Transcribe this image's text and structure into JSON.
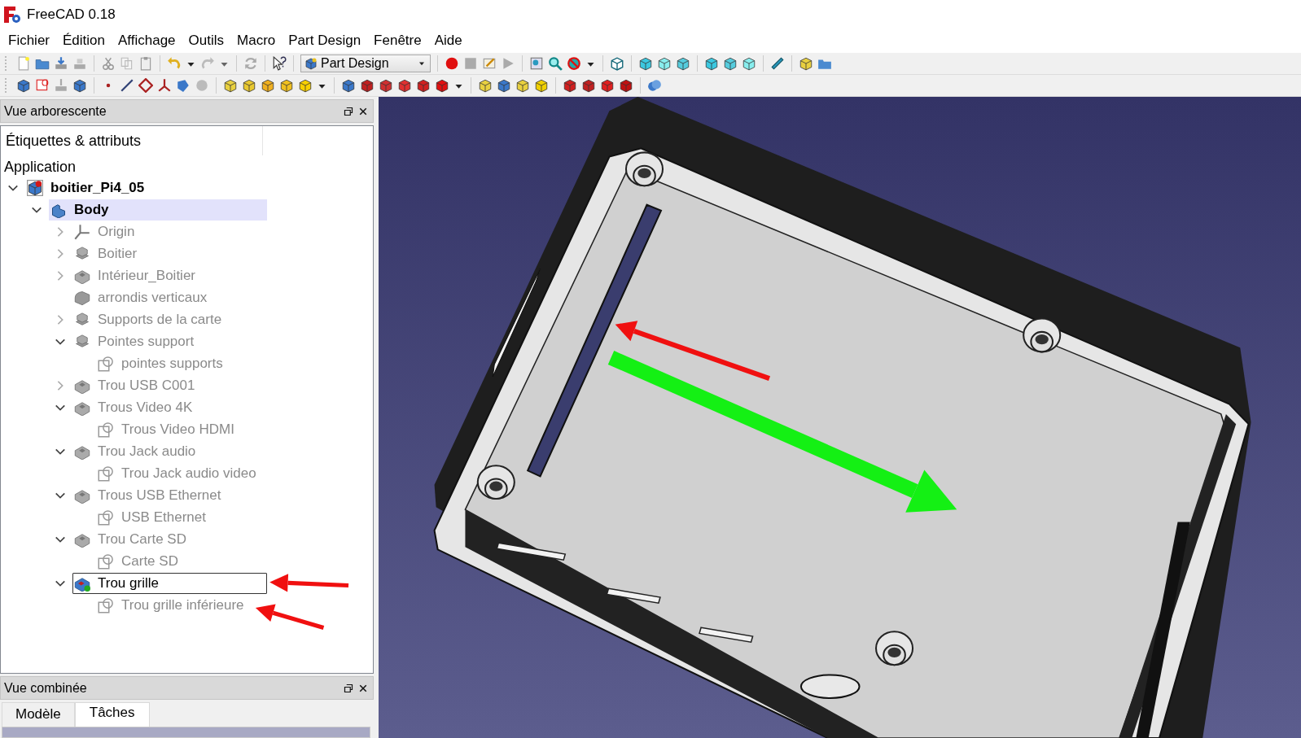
{
  "window": {
    "title": "FreeCAD 0.18"
  },
  "menu": [
    "Fichier",
    "Édition",
    "Affichage",
    "Outils",
    "Macro",
    "Part Design",
    "Fenêtre",
    "Aide"
  ],
  "toolbar": {
    "workbench": "Part Design"
  },
  "tree_view": {
    "title": "Vue arborescente",
    "column_header": "Étiquettes & attributs",
    "section": "Application",
    "items": [
      {
        "label": "boitier_Pi4_05",
        "kind": "document",
        "visible": true,
        "active": false,
        "selected": false,
        "expanded": true,
        "children": [
          {
            "label": "Body",
            "kind": "body",
            "visible": true,
            "active": true,
            "selected": false,
            "expanded": true,
            "children": [
              {
                "label": "Origin",
                "kind": "origin",
                "visible": false,
                "active": false,
                "selected": false,
                "expanded": false
              },
              {
                "label": "Boitier",
                "kind": "pad",
                "visible": false,
                "active": false,
                "selected": false,
                "expanded": false
              },
              {
                "label": "Intérieur_Boitier",
                "kind": "pocket",
                "visible": false,
                "active": false,
                "selected": false,
                "expanded": false
              },
              {
                "label": "arrondis verticaux",
                "kind": "fillet",
                "visible": false,
                "active": false,
                "selected": false
              },
              {
                "label": "Supports de la carte",
                "kind": "pad",
                "visible": false,
                "active": false,
                "selected": false,
                "expanded": false
              },
              {
                "label": "Pointes support",
                "kind": "pad",
                "visible": false,
                "active": false,
                "selected": false,
                "expanded": true,
                "children": [
                  {
                    "label": "pointes supports",
                    "kind": "sketch",
                    "visible": false,
                    "active": false,
                    "selected": false
                  }
                ]
              },
              {
                "label": "Trou USB C001",
                "kind": "pocket",
                "visible": false,
                "active": false,
                "selected": false,
                "expanded": false
              },
              {
                "label": "Trous Video 4K",
                "kind": "pocket",
                "visible": false,
                "active": false,
                "selected": false,
                "expanded": true,
                "children": [
                  {
                    "label": "Trous Video HDMI",
                    "kind": "sketch",
                    "visible": false,
                    "active": false,
                    "selected": false
                  }
                ]
              },
              {
                "label": "Trou Jack audio",
                "kind": "pocket",
                "visible": false,
                "active": false,
                "selected": false,
                "expanded": true,
                "children": [
                  {
                    "label": "Trou Jack audio video",
                    "kind": "sketch",
                    "visible": false,
                    "active": false,
                    "selected": false
                  }
                ]
              },
              {
                "label": "Trous USB Ethernet",
                "kind": "pocket",
                "visible": false,
                "active": false,
                "selected": false,
                "expanded": true,
                "children": [
                  {
                    "label": "USB Ethernet",
                    "kind": "sketch",
                    "visible": false,
                    "active": false,
                    "selected": false
                  }
                ]
              },
              {
                "label": "Trou Carte SD",
                "kind": "pocket",
                "visible": false,
                "active": false,
                "selected": false,
                "expanded": true,
                "children": [
                  {
                    "label": "Carte SD",
                    "kind": "sketch",
                    "visible": false,
                    "active": false,
                    "selected": false
                  }
                ]
              },
              {
                "label": "Trou grille",
                "kind": "pattern",
                "visible": true,
                "active": false,
                "selected": true,
                "expanded": true,
                "children": [
                  {
                    "label": "Trou grille inférieure",
                    "kind": "sketch",
                    "visible": false,
                    "active": false,
                    "selected": false
                  }
                ]
              }
            ]
          }
        ]
      }
    ]
  },
  "combo_view": {
    "title": "Vue combinée",
    "tabs": [
      {
        "label": "Modèle",
        "selected": false
      },
      {
        "label": "Tâches",
        "selected": true
      }
    ]
  }
}
